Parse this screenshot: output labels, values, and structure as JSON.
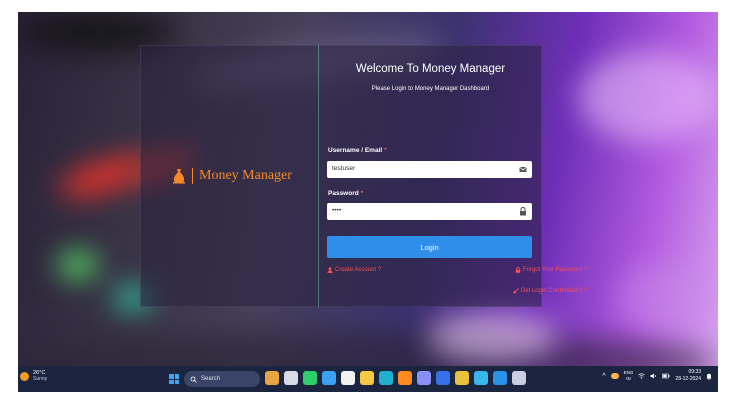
{
  "login": {
    "brand_name": "Money Manager",
    "welcome_title": "Welcome To Money Manager",
    "subtitle": "Please Login to Money Manager Dashboard",
    "username_label": "Username / Email",
    "username_value": "testuser",
    "password_label": "Password",
    "password_value": "••••",
    "required_mark": "*",
    "login_button": "Login",
    "create_account": "Create Account ?",
    "forgot_password": "Forgot Your Password ?",
    "get_credentials": "Get Login Credentials? ?"
  },
  "taskbar": {
    "weather_temp": "26°C",
    "weather_cond": "Sunny",
    "search_label": "Search",
    "lang_top": "ENG",
    "lang_bottom": "IN",
    "time": "09:33",
    "date": "28-12-2024",
    "apps": [
      {
        "name": "app-icon-widgets",
        "color": "#e9a640"
      },
      {
        "name": "app-icon-taskview",
        "color": "#d8dbe6"
      },
      {
        "name": "app-icon-whatsapp",
        "color": "#2ecf6b"
      },
      {
        "name": "app-icon-chrome-like",
        "color": "#3aa0f0"
      },
      {
        "name": "app-icon-store",
        "color": "#f2f2f2"
      },
      {
        "name": "app-icon-files",
        "color": "#f6c945"
      },
      {
        "name": "app-icon-edge",
        "color": "#1fb1d0"
      },
      {
        "name": "app-icon-firefox",
        "color": "#ff8a1f"
      },
      {
        "name": "app-icon-teams",
        "color": "#8a90f5"
      },
      {
        "name": "app-icon-word",
        "color": "#3571e6"
      },
      {
        "name": "app-icon-chrome",
        "color": "#e8c23a"
      },
      {
        "name": "app-icon-copilot",
        "color": "#39b7e8"
      },
      {
        "name": "app-icon-vscode",
        "color": "#2a93e8"
      },
      {
        "name": "app-icon-notepad",
        "color": "#c9cfe0"
      }
    ]
  },
  "colors": {
    "accent": "#2f8fe8",
    "brand_orange": "#f7892c",
    "link_red": "#ff4d4d"
  }
}
